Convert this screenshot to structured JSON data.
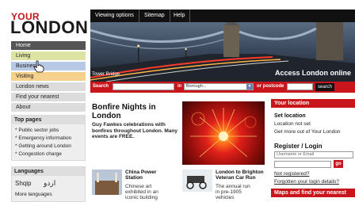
{
  "logo": {
    "line1": "YOUR",
    "line2": "LONDON"
  },
  "topnav": {
    "items": [
      "Viewing options",
      "Sitemap",
      "Help"
    ]
  },
  "hero": {
    "caption": "Tower Bridge",
    "access_text": "Access London online"
  },
  "search": {
    "label": "Search",
    "in_label": "in",
    "borough_value": "Borough...",
    "postcode_label": "or postcode",
    "button": "search"
  },
  "sidebar": {
    "nav": [
      "Home",
      "Living",
      "Business",
      "Visiting",
      "London news",
      "Find your nearest",
      "About"
    ],
    "top_pages": {
      "heading": "Top pages",
      "items": [
        "* Public sector jobs",
        "* Emergency information",
        "* Getting around London",
        "* Congestion charge"
      ]
    },
    "languages": {
      "heading": "Languages",
      "items": [
        "Shqip",
        "اردو"
      ],
      "more": "More languages"
    }
  },
  "article": {
    "title_line1": "Bonfire Nights in",
    "title_line2": "London",
    "body": "Guy Fawkes celebrations with bonfires throughout London. Many events are FREE."
  },
  "news": [
    {
      "title_line1": "China Power",
      "title_line2": "Station",
      "text_line1": "Chinese art",
      "text_line2": "exhibited in an",
      "text_line3": "iconic building"
    },
    {
      "title_line1": "London to Brighton",
      "title_line2": "Veteran Car Run",
      "text_line1": "The annual run",
      "text_line2": "in pre-1905",
      "text_line3": "vehicles"
    }
  ],
  "right": {
    "your_location_head": "Your location",
    "set_location": "Set location",
    "location_status": "Location not set",
    "get_more": "Get more out of Your London",
    "register_heading": "Register / Login",
    "username_placeholder": "Username or Email",
    "go": "go",
    "not_registered": "Not registered?",
    "forgotten": "Forgotten your login details?",
    "maps_head": "Maps and find your nearest"
  }
}
